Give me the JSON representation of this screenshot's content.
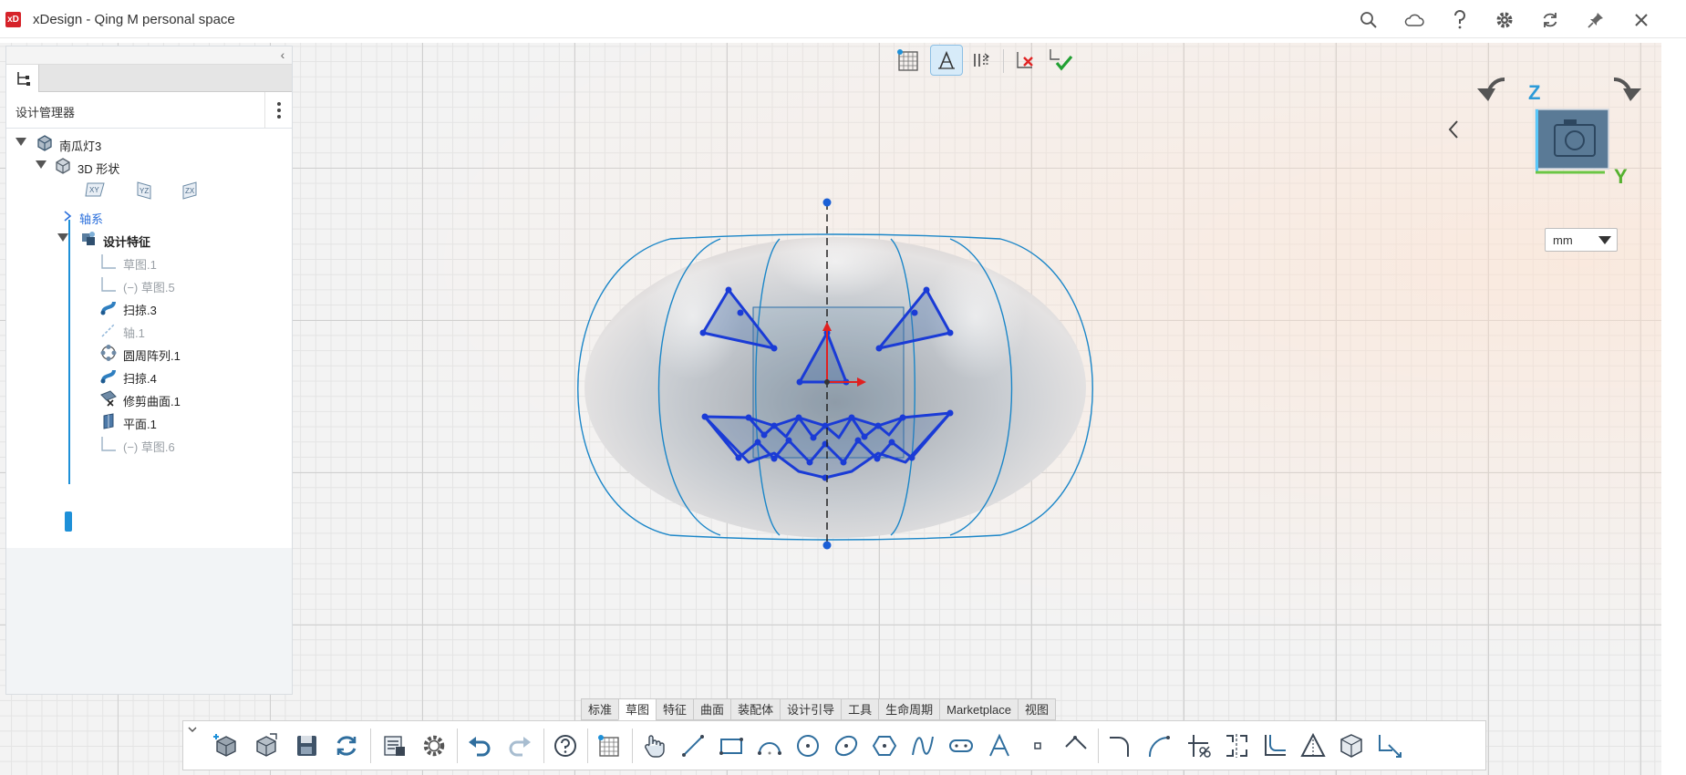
{
  "app": {
    "title": "xDesign - Qing M personal space",
    "logo_text": "xD",
    "logo_color": "#d6232a"
  },
  "titlebar_icons": [
    "search-icon",
    "cloud-icon",
    "help-icon",
    "gear-icon",
    "refresh-icon",
    "pin-icon",
    "close-icon"
  ],
  "design_manager": {
    "title": "设计管理器",
    "tree": [
      {
        "label": "南瓜灯3",
        "icon": "part-icon",
        "expanded": true,
        "state": "normal"
      },
      {
        "label": "3D 形状",
        "icon": "shape-3d-icon",
        "expanded": true,
        "state": "normal"
      },
      {
        "label": "XY",
        "icon": "plane-xy-icon"
      },
      {
        "label": "YZ",
        "icon": "plane-yz-icon"
      },
      {
        "label": "ZX",
        "icon": "plane-zx-icon"
      },
      {
        "label": "轴系",
        "icon": "chevron-right-icon",
        "state": "link"
      },
      {
        "label": "设计特征",
        "icon": "design-features-icon",
        "expanded": true,
        "state": "bold"
      },
      {
        "label": "草图.1",
        "icon": "sketch-icon",
        "state": "dim"
      },
      {
        "label": "(−)   草图.5",
        "icon": "sketch-icon",
        "state": "dim"
      },
      {
        "label": "扫掠.3",
        "icon": "sweep-icon",
        "state": "normal"
      },
      {
        "label": "轴.1",
        "icon": "axis-icon",
        "state": "dim"
      },
      {
        "label": "圆周阵列.1",
        "icon": "circular-pattern-icon",
        "state": "normal"
      },
      {
        "label": "扫掠.4",
        "icon": "sweep-icon",
        "state": "normal"
      },
      {
        "label": "修剪曲面.1",
        "icon": "trim-surface-icon",
        "state": "normal"
      },
      {
        "label": "平面.1",
        "icon": "plane-icon",
        "state": "normal"
      },
      {
        "label": "(−)   草图.6",
        "icon": "sketch-icon",
        "state": "dim"
      }
    ]
  },
  "viewcube": {
    "z_label": "Z",
    "y_label": "Y",
    "units": "mm"
  },
  "ribbon": {
    "tabs": [
      "标准",
      "草图",
      "特征",
      "曲面",
      "装配体",
      "设计引导",
      "工具",
      "生命周期",
      "Marketplace",
      "视图"
    ],
    "active_tab": "草图"
  },
  "colors": {
    "sketch_line": "#1a3bd6",
    "surface_edge": "#1b86c8",
    "accent": "#1e90d8"
  }
}
